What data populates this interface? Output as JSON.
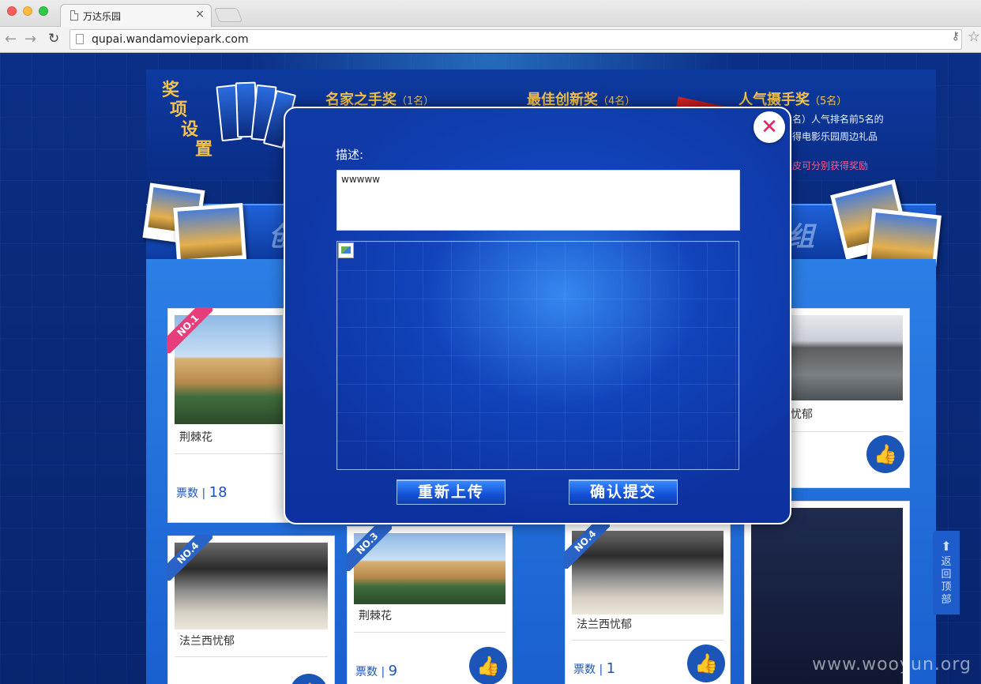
{
  "browser": {
    "tab_title": "万达乐园",
    "tab_close": "×",
    "url": "qupai.wandamoviepark.com"
  },
  "awards": {
    "title_chars": [
      "奖",
      "项",
      "设",
      "置"
    ],
    "items": [
      {
        "name": "名家之手奖",
        "count": "（1名）"
      },
      {
        "name": "最佳创新奖",
        "count": "（4名）"
      },
      {
        "name": "人气摄手奖",
        "count": "（5名）"
      }
    ],
    "desc_line1": "名）人气排名前5名的",
    "desc_line2": "得电影乐园周边礼品",
    "note": "皮可分别获得奖励"
  },
  "banner": {
    "left_char": "创",
    "right_char": "组"
  },
  "cards": [
    {
      "rank": "NO.1",
      "title": "荆棘花",
      "votes_label": "票数",
      "votes": "18"
    },
    {
      "rank": "",
      "title": "忧郁",
      "votes_label": "",
      "votes": ""
    },
    {
      "rank": "NO.4",
      "title": "法兰西忧郁",
      "votes_label": "",
      "votes": ""
    },
    {
      "rank": "NO.3",
      "title": "荆棘花",
      "votes_label": "票数",
      "votes": "9"
    },
    {
      "rank": "NO.4",
      "title": "法兰西忧郁",
      "votes_label": "票数",
      "votes": "1"
    }
  ],
  "back_to_top": [
    "返",
    "回",
    "顶",
    "部"
  ],
  "watermark": "www.wooyun.org",
  "modal": {
    "close_symbol": "✕",
    "description_label": "描述:",
    "description_value": "wwwww",
    "reupload_label": "重新上传",
    "submit_label": "确认提交"
  },
  "colors": {
    "accent_gold": "#f5c34b",
    "modal_blue": "#103aa8",
    "close_pink": "#e0245e",
    "ribbon_pink": "#e73d7b"
  },
  "icons": [
    "page-icon",
    "back-arrow-icon",
    "forward-arrow-icon",
    "reload-icon",
    "key-icon",
    "star-icon",
    "close-icon",
    "thumbs-up-icon",
    "broken-image-icon",
    "up-arrow-icon"
  ]
}
